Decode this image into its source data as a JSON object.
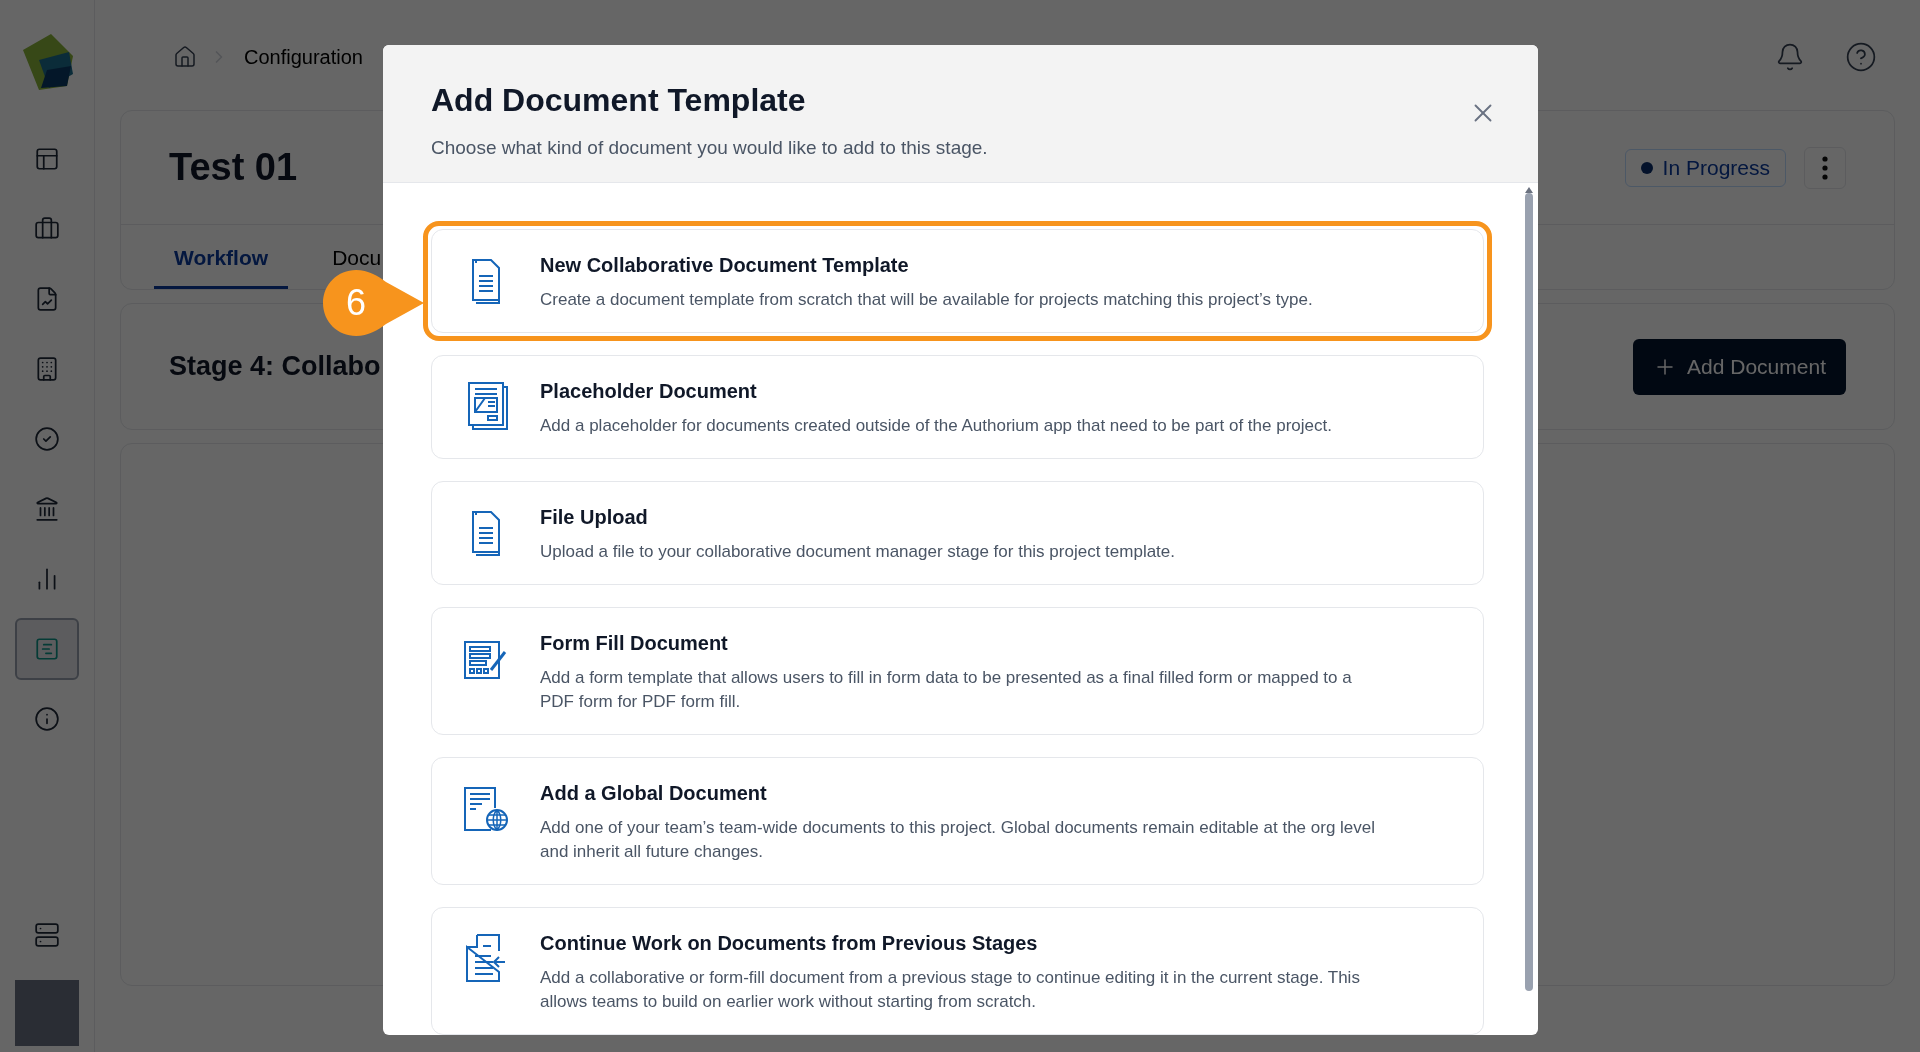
{
  "sidebar": {
    "items": [
      {
        "kind": "layout",
        "selected": false
      },
      {
        "kind": "briefcase",
        "selected": false
      },
      {
        "kind": "report",
        "selected": false
      },
      {
        "kind": "building",
        "selected": false
      },
      {
        "kind": "check",
        "selected": false
      },
      {
        "kind": "bank",
        "selected": false
      },
      {
        "kind": "chart",
        "selected": false
      },
      {
        "kind": "board",
        "selected": true
      },
      {
        "kind": "info",
        "selected": false
      }
    ],
    "bottom": [
      {
        "kind": "server",
        "selected": false
      }
    ]
  },
  "breadcrumb": {
    "items": [
      "Configuration"
    ]
  },
  "project": {
    "title": "Test 01",
    "status": "In Progress",
    "tabs": [
      {
        "label": "Workflow",
        "selected": true
      },
      {
        "label": "Docu",
        "selected": false
      }
    ]
  },
  "stage": {
    "title": "Stage 4: Collabo",
    "button": "Add Document"
  },
  "dialog": {
    "title": "Add Document Template",
    "subtitle": "Choose what kind of document you would like to add to this stage.",
    "options": [
      {
        "kind": "document",
        "title": "New Collaborative Document Template",
        "description": "Create a document template from scratch that will be available for projects matching this project’s type.",
        "highlighted": true
      },
      {
        "kind": "placeholder",
        "title": "Placeholder Document",
        "description": "Add a placeholder for documents created outside of the Authorium app that need to be part of the project.",
        "highlighted": false
      },
      {
        "kind": "document",
        "title": "File Upload",
        "description": "Upload a file to your collaborative document manager stage for this project template.",
        "highlighted": false
      },
      {
        "kind": "form",
        "title": "Form Fill Document",
        "description": "Add a form template that allows users to fill in form data to be presented as a final filled form or mapped to a PDF form for PDF form fill.",
        "highlighted": false
      },
      {
        "kind": "global",
        "title": "Add a Global Document",
        "description": "Add one of your team’s team-wide documents to this project. Global documents remain editable at the org level and inherit all future changes.",
        "highlighted": false
      },
      {
        "kind": "continue",
        "title": "Continue Work on Documents from Previous Stages",
        "description": "Add a collaborative or form-fill document from a previous stage to continue editing it in the current stage. This allows teams to build on earlier work without starting from scratch.",
        "highlighted": false
      }
    ]
  },
  "callout": "6"
}
